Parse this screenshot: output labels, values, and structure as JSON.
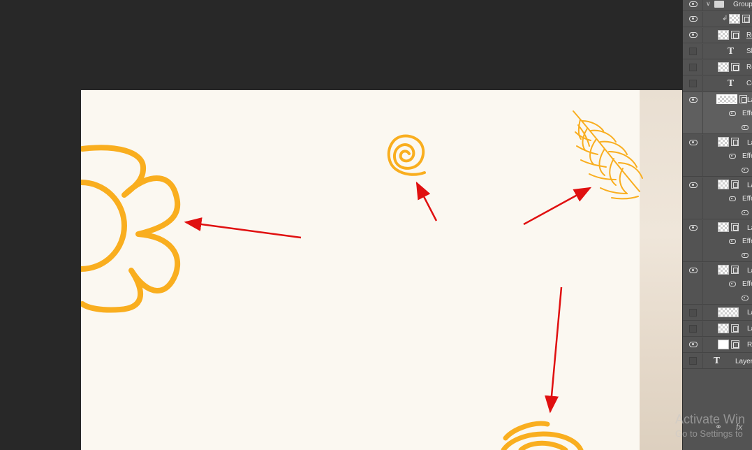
{
  "layers_panel": {
    "rows": [
      {
        "id": "group",
        "name": "Group",
        "visible": true,
        "type": "group"
      },
      {
        "id": "clip",
        "name": "",
        "visible": true,
        "type": "smart",
        "clipped": true
      },
      {
        "id": "rect1",
        "name": "Re",
        "visible": true,
        "type": "shape",
        "underlined": true
      },
      {
        "id": "text1",
        "name": "Sl",
        "visible": false,
        "type": "text"
      },
      {
        "id": "rect2",
        "name": "Re",
        "visible": false,
        "type": "shape"
      },
      {
        "id": "text2",
        "name": "Co",
        "visible": false,
        "type": "text"
      },
      {
        "id": "layer1",
        "name": "La",
        "visible": true,
        "type": "smart",
        "selected": true,
        "effects_label": "Effe"
      },
      {
        "id": "layer2",
        "name": "La",
        "visible": true,
        "type": "smart",
        "effects_label": "Effe"
      },
      {
        "id": "layer3",
        "name": "La",
        "visible": true,
        "type": "smart",
        "effects_label": "Effe"
      },
      {
        "id": "layer4",
        "name": "La",
        "visible": true,
        "type": "smart",
        "effects_label": "Effe"
      },
      {
        "id": "layer5",
        "name": "La",
        "visible": true,
        "type": "smart",
        "effects_label": "Effe"
      },
      {
        "id": "layer6",
        "name": "La",
        "visible": false,
        "type": "pixel"
      },
      {
        "id": "layer7",
        "name": "La",
        "visible": false,
        "type": "smart"
      },
      {
        "id": "rect3",
        "name": "Re",
        "visible": true,
        "type": "shape-white"
      },
      {
        "id": "text3",
        "name": "Layer",
        "visible": false,
        "type": "text"
      }
    ],
    "footer_icons": [
      "link-icon",
      "fx-icon"
    ],
    "fx_label": "fx"
  },
  "watermark": {
    "line1": "Activate Win",
    "line2": "Go to Settings to"
  },
  "colors": {
    "workspace": "#282828",
    "canvas": "#fbf8f1",
    "artwork": "#f9ae1f",
    "arrow": "#e01010",
    "panel": "#535353"
  },
  "canvas_icons": [
    "flower-icon",
    "spiral-icon",
    "fern-leaf-icon",
    "spiral-icon"
  ]
}
